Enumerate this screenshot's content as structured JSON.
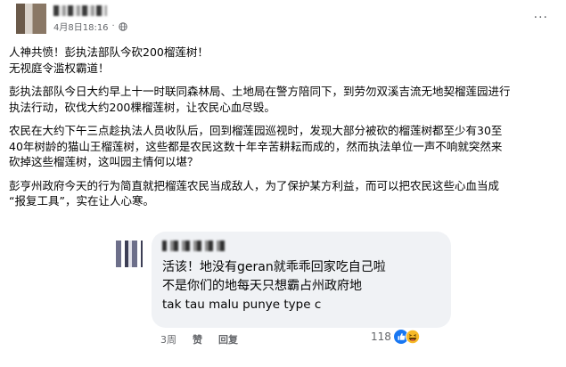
{
  "post": {
    "timestamp": "4月8日18:16",
    "title_line_1": "人神共愤！彭执法部队今砍200榴莲树！",
    "title_line_2": "无视庭令滥权霸道！",
    "para1_line_1": "彭执法部队今日大约早上十一时联同森林局、土地局在警方陪同下，到劳勿双溪吉流无地契榴莲园进行",
    "para1_line_2": "执法行动，砍伐大约200棵榴莲树，让农民心血尽毁。",
    "para2_line_1": "农民在大约下午三点趁执法人员收队后，回到榴莲园巡视时，发现大部分被砍的榴莲树都至少有30至",
    "para2_line_2": "40年树龄的猫山王榴莲树，这些都是农民这数十年辛苦耕耘而成的，然而执法单位一声不响就突然来",
    "para2_line_3": "砍掉这些榴莲树，这叫园主情何以堪？",
    "para3_line_1": "彭亨州政府今天的行为简直就把榴莲农民当成敌人，为了保护某方利益，而可以把农民这些心血当成",
    "para3_line_2": "“报复工具”，实在让人心寒。"
  },
  "comment": {
    "line_1": "活该！地没有geran就乖乖回家吃自己啦",
    "line_2": "不是你们的地每天只想霸占州政府地",
    "line_3": "tak tau malu punye type c",
    "time": "3周",
    "like_label": "赞",
    "reply_label": "回复",
    "reaction_count": "118"
  },
  "colors": {
    "meta_gray": "#65676b",
    "bubble_bg": "#f0f2f5",
    "like_blue": "#1877f2",
    "haha_yellow": "#f7b928"
  },
  "icons": [
    "globe-icon",
    "more-icon",
    "like-reaction-icon",
    "haha-reaction-icon"
  ]
}
